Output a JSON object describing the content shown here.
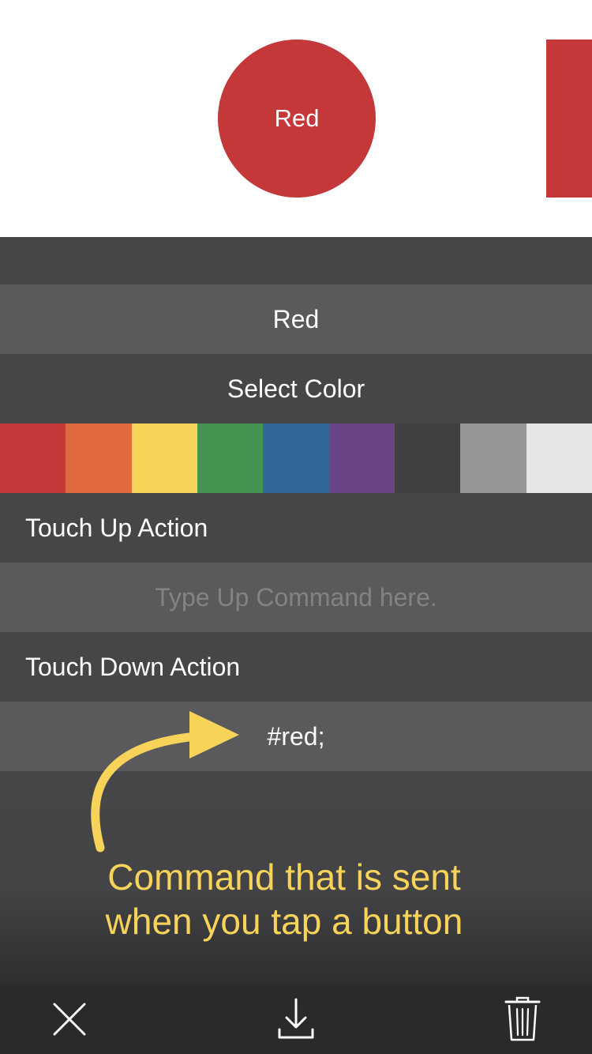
{
  "preview": {
    "button_label": "Red",
    "button_color": "#c4383a"
  },
  "editor": {
    "name_value": "Red",
    "select_color_label": "Select Color",
    "palette": [
      {
        "name": "red",
        "color": "#c4383a"
      },
      {
        "name": "orange",
        "color": "#e06a3b"
      },
      {
        "name": "yellow",
        "color": "#f7d359"
      },
      {
        "name": "green",
        "color": "#44934f"
      },
      {
        "name": "blue",
        "color": "#326898"
      },
      {
        "name": "purple",
        "color": "#6a4585"
      },
      {
        "name": "dark-gray",
        "color": "#404042"
      },
      {
        "name": "gray",
        "color": "#959598"
      },
      {
        "name": "light-gray",
        "color": "#e4e5e7"
      }
    ],
    "touch_up_label": "Touch Up Action",
    "touch_up_placeholder": "Type Up Command here.",
    "touch_up_value": "",
    "touch_down_label": "Touch Down Action",
    "touch_down_value": "#red;"
  },
  "annotation": {
    "text_line1": "Command that is sent",
    "text_line2": "when you tap a button",
    "color": "#f7d35a"
  },
  "toolbar": {
    "close_icon": "close-icon",
    "save_icon": "download-icon",
    "delete_icon": "trash-icon"
  }
}
